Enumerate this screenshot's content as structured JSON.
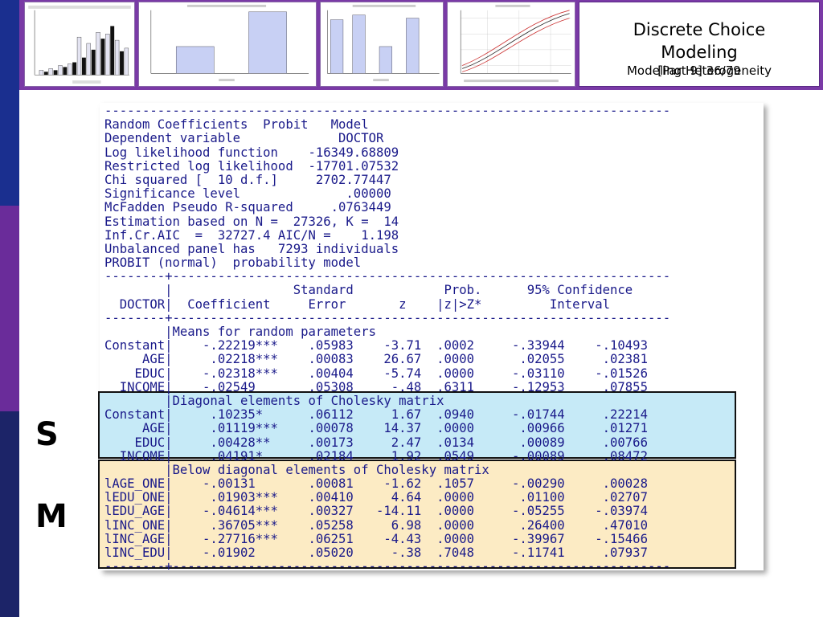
{
  "slide": {
    "title_line1": "Discrete Choice",
    "title_line2": "Modeling",
    "subtitle_left": "Modeling Heterogeneity",
    "subtitle_right": "[Part 9]    36/79",
    "letter_s": "S",
    "letter_m": "M"
  },
  "colors": {
    "sidebar_blue": "#1a2f8f",
    "sidebar_purple": "#6a2c9a",
    "sidebar_navy": "#1c2468",
    "top_band": "#7a3aa6",
    "output_text": "#1a1a8a",
    "highlight_blue": "#c6eaf7",
    "highlight_yellow": "#fcebc4"
  },
  "output_lines": [
    "---------------------------------------------------------------------------",
    "Random Coefficients  Probit   Model",
    "Dependent variable             DOCTOR",
    "Log likelihood function    -16349.68809",
    "Restricted log likelihood  -17701.07532",
    "Chi squared [  10 d.f.]     2702.77447",
    "Significance level              .00000",
    "McFadden Pseudo R-squared     .0763449",
    "Estimation based on N =  27326, K =  14",
    "Inf.Cr.AIC  =  32727.4 AIC/N =    1.198",
    "Unbalanced panel has   7293 individuals",
    "PROBIT (normal)  probability model",
    "--------+------------------------------------------------------------------",
    "        |                Standard            Prob.      95% Confidence",
    "  DOCTOR|  Coefficient     Error       z    |z|>Z*         Interval",
    "--------+------------------------------------------------------------------",
    "        |Means for random parameters",
    "Constant|    -.22219***    .05983    -3.71  .0002     -.33944    -.10493",
    "     AGE|     .02218***    .00083    26.67  .0000      .02055     .02381",
    "    EDUC|    -.02318***    .00404    -5.74  .0000     -.03110    -.01526",
    "  INCOME|    -.02549       .05308     -.48  .6311     -.12953     .07855",
    "        |Diagonal elements of Cholesky matrix",
    "Constant|     .10235*      .06112     1.67  .0940     -.01744     .22214",
    "     AGE|     .01119***    .00078    14.37  .0000      .00966     .01271",
    "    EDUC|     .00428**     .00173     2.47  .0134      .00089     .00766",
    "  INCOME|     .04191*      .02184     1.92  .0549     -.00089     .08472",
    "        |Below diagonal elements of Cholesky matrix",
    "lAGE_ONE|    -.00131       .00081    -1.62  .1057     -.00290     .00028",
    "lEDU_ONE|     .01903***    .00410     4.64  .0000      .01100     .02707",
    "lEDU_AGE|    -.04614***    .00327   -14.11  .0000     -.05255    -.03974",
    "lINC_ONE|     .36705***    .05258     6.98  .0000      .26400     .47010",
    "lINC_AGE|    -.27716***    .06251    -4.43  .0000     -.39967    -.15466",
    "lINC_EDU|    -.01902       .05020     -.38  .7048     -.11741     .07937",
    "--------+------------------------------------------------------------------"
  ]
}
